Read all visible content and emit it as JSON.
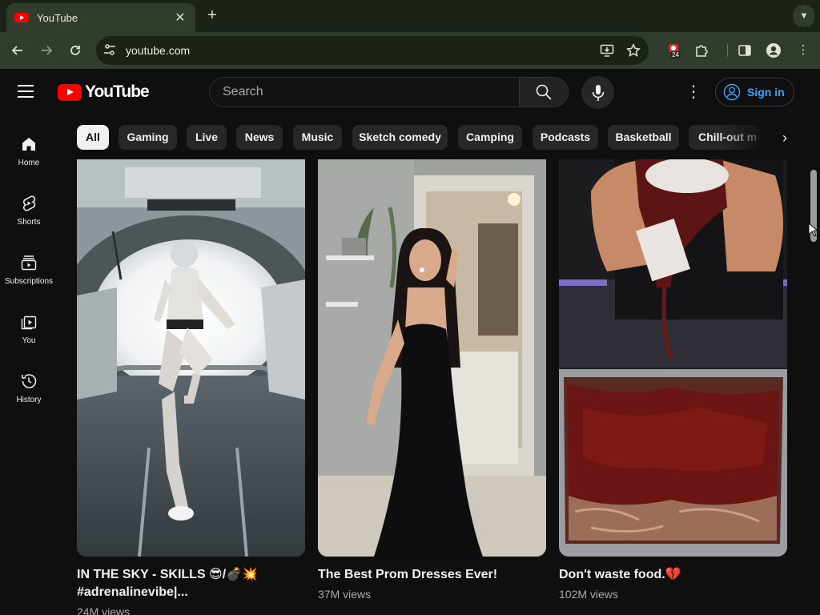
{
  "browser": {
    "tab_title": "YouTube",
    "new_tab": "+",
    "url": "youtube.com",
    "extension_badge": "24"
  },
  "header": {
    "logo_text": "YouTube",
    "search_placeholder": "Search",
    "signin_label": "Sign in"
  },
  "sidebar": {
    "items": [
      {
        "label": "Home",
        "icon": "home-icon"
      },
      {
        "label": "Shorts",
        "icon": "shorts-icon"
      },
      {
        "label": "Subscriptions",
        "icon": "subscriptions-icon"
      },
      {
        "label": "You",
        "icon": "you-icon"
      },
      {
        "label": "History",
        "icon": "history-icon"
      }
    ]
  },
  "chips": [
    "All",
    "Gaming",
    "Live",
    "News",
    "Music",
    "Sketch comedy",
    "Camping",
    "Podcasts",
    "Basketball",
    "Chill-out m"
  ],
  "shorts": [
    {
      "title_line1": "IN THE SKY - SKILLS 😎/💣💥",
      "title_line2": "#adrenalinevibe|...",
      "views": "24M views"
    },
    {
      "title_line1": "The Best Prom Dresses Ever!",
      "views": "37M views"
    },
    {
      "title_line1": "Don't waste food.💔",
      "views": "102M views"
    }
  ],
  "colors": {
    "chrome_dark": "#1b2218",
    "chrome_toolbar": "#323c2d",
    "yt_background": "#0f0f0f",
    "yt_red": "#ff0000",
    "signin_blue": "#3ea6ff"
  }
}
